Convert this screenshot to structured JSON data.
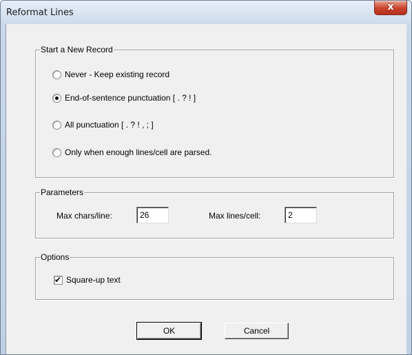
{
  "window": {
    "title": "Reformat Lines",
    "close_glyph": "x"
  },
  "start_record": {
    "legend": "Start a New Record",
    "options": [
      {
        "label": "Never - Keep existing record",
        "checked": false
      },
      {
        "label": "End-of-sentence punctuation [ . ? ! ]",
        "checked": true
      },
      {
        "label": "All punctuation [ . ? ! , ; ]",
        "checked": false
      },
      {
        "label": "Only when enough lines/cell are parsed.",
        "checked": false
      }
    ]
  },
  "parameters": {
    "legend": "Parameters",
    "max_chars_label": "Max chars/line:",
    "max_chars_value": "26",
    "max_lines_label": "Max lines/cell:",
    "max_lines_value": "2"
  },
  "options": {
    "legend": "Options",
    "square_up_label": "Square-up text",
    "square_up_checked": true,
    "check_glyph": "✔"
  },
  "buttons": {
    "ok": "OK",
    "cancel": "Cancel"
  }
}
